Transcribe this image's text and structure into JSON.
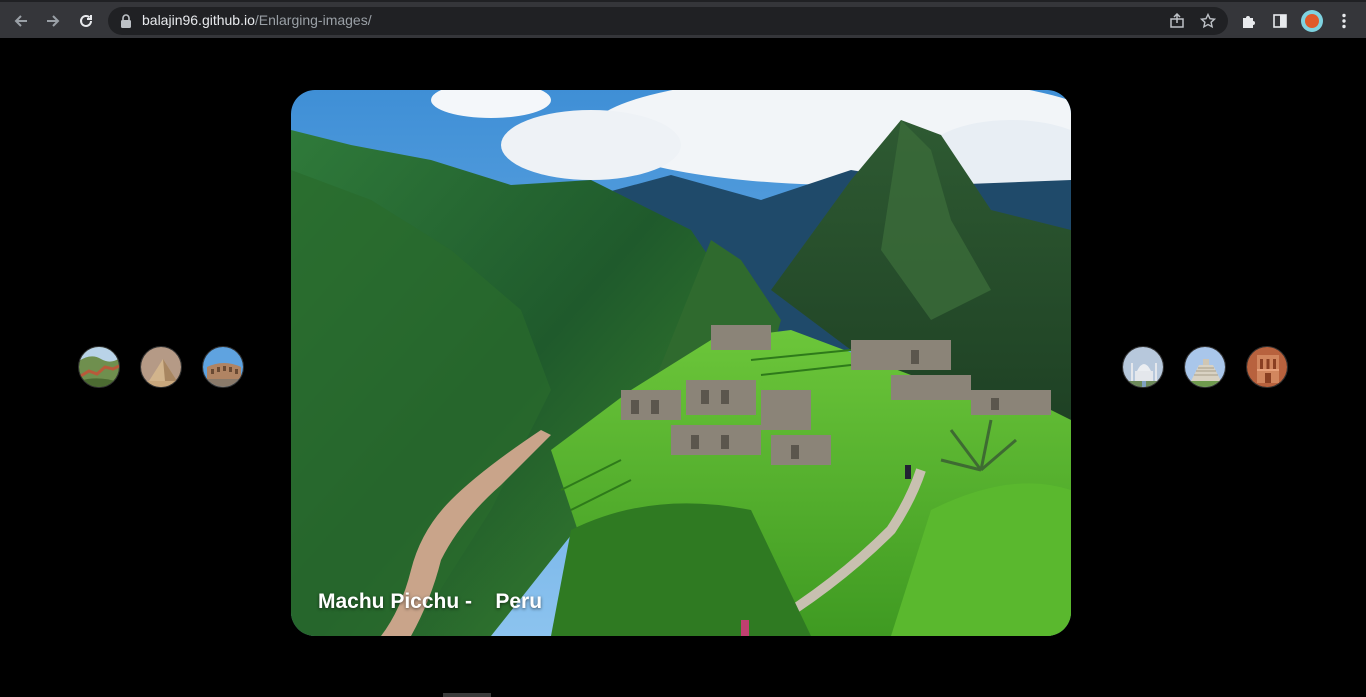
{
  "browser": {
    "url_host": "balajin96.github.io",
    "url_path": "/Enlarging-images/"
  },
  "main_image": {
    "title": "Machu Picchu -",
    "country": "Peru"
  },
  "thumbnails_left": [
    {
      "name": "thumb-great-wall",
      "icon": "great-wall-thumbnail"
    },
    {
      "name": "thumb-pyramids",
      "icon": "pyramids-thumbnail"
    },
    {
      "name": "thumb-colosseum",
      "icon": "colosseum-thumbnail"
    }
  ],
  "thumbnails_right": [
    {
      "name": "thumb-taj-mahal",
      "icon": "taj-mahal-thumbnail"
    },
    {
      "name": "thumb-chichen-itza",
      "icon": "chichen-itza-thumbnail"
    },
    {
      "name": "thumb-petra",
      "icon": "petra-thumbnail"
    }
  ]
}
